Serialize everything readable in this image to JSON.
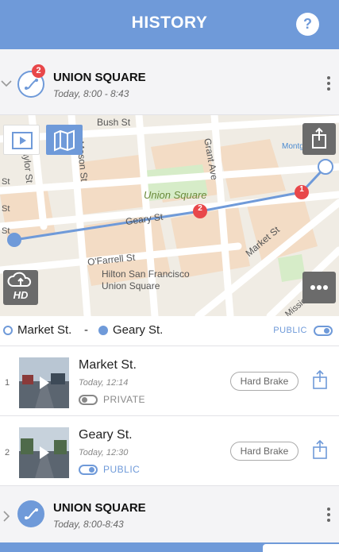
{
  "header": {
    "title": "HISTORY",
    "help_label": "?"
  },
  "route_top": {
    "name": "UNION SQUARE",
    "time": "Today, 8:00 - 8:43",
    "badge_count": "2"
  },
  "map": {
    "labels": {
      "bush_st": "Bush St",
      "grant_ave": "Grant Ave",
      "montgomery": "Montgomery",
      "mason_st": "Mason St",
      "taylor_st": "aylor St",
      "st1": "St",
      "st2": "St",
      "st3": "St",
      "union_square": "Union Square",
      "geary_st": "Geary St",
      "ofarrell_st": "O'Farrell St",
      "market_st": "Market St",
      "hilton": "Hilton San Francisco",
      "hilton2": "Union Square",
      "mission_st": "Mission St",
      "hd": "HD"
    },
    "markers": {
      "m1": "1",
      "m2": "2"
    }
  },
  "route_ends": {
    "start": "Market St.",
    "separator": "-",
    "end": "Geary St.",
    "visibility_label": "PUBLIC"
  },
  "clips": [
    {
      "index": "1",
      "title": "Market St.",
      "time": "Today, 12:14",
      "privacy": "PRIVATE",
      "tag": "Hard Brake"
    },
    {
      "index": "2",
      "title": "Geary St.",
      "time": "Today, 12:30",
      "privacy": "PUBLIC",
      "tag": "Hard Brake"
    }
  ],
  "route_bottom": {
    "name": "UNION SQUARE",
    "time": "Today, 8:00-8:43"
  },
  "colors": {
    "accent": "#6f9ad9",
    "marker": "#e8474a",
    "header_bg": "#6f9ad9"
  }
}
